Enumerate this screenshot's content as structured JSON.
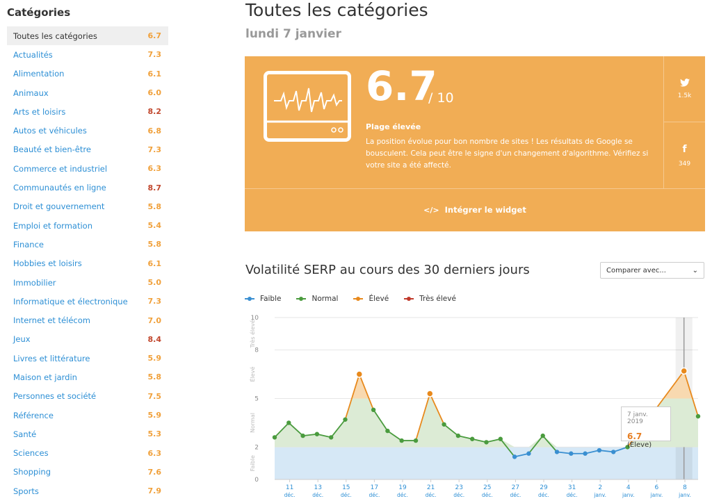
{
  "sidebar": {
    "title": "Catégories",
    "items": [
      {
        "label": "Toutes les catégories",
        "value": "6.7",
        "active": true,
        "color": "orange"
      },
      {
        "label": "Actualités",
        "value": "7.3",
        "color": "orange"
      },
      {
        "label": "Alimentation",
        "value": "6.1",
        "color": "orange"
      },
      {
        "label": "Animaux",
        "value": "6.0",
        "color": "orange"
      },
      {
        "label": "Arts et loisirs",
        "value": "8.2",
        "color": "red"
      },
      {
        "label": "Autos et véhicules",
        "value": "6.8",
        "color": "orange"
      },
      {
        "label": "Beauté et bien-être",
        "value": "7.3",
        "color": "orange"
      },
      {
        "label": "Commerce et industriel",
        "value": "6.3",
        "color": "orange"
      },
      {
        "label": "Communautés en ligne",
        "value": "8.7",
        "color": "red"
      },
      {
        "label": "Droit et gouvernement",
        "value": "5.8",
        "color": "orange"
      },
      {
        "label": "Emploi et formation",
        "value": "5.4",
        "color": "orange"
      },
      {
        "label": "Finance",
        "value": "5.8",
        "color": "orange"
      },
      {
        "label": "Hobbies et loisirs",
        "value": "6.1",
        "color": "orange"
      },
      {
        "label": "Immobilier",
        "value": "5.0",
        "color": "orange"
      },
      {
        "label": "Informatique et électronique",
        "value": "7.3",
        "color": "orange"
      },
      {
        "label": "Internet et télécom",
        "value": "7.0",
        "color": "orange"
      },
      {
        "label": "Jeux",
        "value": "8.4",
        "color": "red"
      },
      {
        "label": "Livres et littérature",
        "value": "5.9",
        "color": "orange"
      },
      {
        "label": "Maison et jardin",
        "value": "5.8",
        "color": "orange"
      },
      {
        "label": "Personnes et société",
        "value": "7.5",
        "color": "orange"
      },
      {
        "label": "Référence",
        "value": "5.9",
        "color": "orange"
      },
      {
        "label": "Santé",
        "value": "5.3",
        "color": "orange"
      },
      {
        "label": "Sciences",
        "value": "6.3",
        "color": "orange"
      },
      {
        "label": "Shopping",
        "value": "7.6",
        "color": "orange"
      },
      {
        "label": "Sports",
        "value": "7.9",
        "color": "orange"
      }
    ]
  },
  "header": {
    "title": "Toutes les catégories",
    "date": "lundi 7 janvier"
  },
  "card": {
    "score": "6.7",
    "score_max": "/ 10",
    "range_label": "Plage élevée",
    "description": "La position évolue pour bon nombre de sites ! Les résultats de Google se bousculent. Cela peut être le signe d'un changement d'algorithme. Vérifiez si votre site a été affecté.",
    "twitter_count": "1.5k",
    "facebook_count": "349",
    "embed_label": "Intégrer le widget",
    "bg_color": "#f1ad55"
  },
  "chart_section": {
    "title": "Volatilité SERP au cours des 30 derniers jours",
    "compare_label": "Comparer avec...",
    "legend": [
      {
        "name": "Faible",
        "color": "#3a8fd1"
      },
      {
        "name": "Normal",
        "color": "#4a9b3e"
      },
      {
        "name": "Élevé",
        "color": "#e8891c"
      },
      {
        "name": "Très élevé",
        "color": "#c0392b"
      }
    ],
    "tooltip": {
      "date": "7 janv. 2019",
      "value": "6.7",
      "label": "(Eleve)"
    }
  },
  "chart_data": {
    "type": "line",
    "ylim": [
      0,
      10
    ],
    "yticks": [
      0,
      2,
      5,
      8,
      10
    ],
    "band_labels": [
      "Faible",
      "Normal",
      "Élevé",
      "Très élevé"
    ],
    "bands": [
      0,
      2,
      5,
      8,
      10
    ],
    "xticks": [
      {
        "day": "11",
        "month": "déc."
      },
      {
        "day": "13",
        "month": "déc."
      },
      {
        "day": "15",
        "month": "déc."
      },
      {
        "day": "17",
        "month": "déc."
      },
      {
        "day": "19",
        "month": "déc."
      },
      {
        "day": "21",
        "month": "déc."
      },
      {
        "day": "23",
        "month": "déc."
      },
      {
        "day": "25",
        "month": "déc."
      },
      {
        "day": "27",
        "month": "déc."
      },
      {
        "day": "29",
        "month": "déc."
      },
      {
        "day": "31",
        "month": "déc."
      },
      {
        "day": "2",
        "month": "janv."
      },
      {
        "day": "4",
        "month": "janv."
      },
      {
        "day": "6",
        "month": "janv."
      },
      {
        "day": "8",
        "month": "janv."
      }
    ],
    "series": [
      {
        "values": [
          {
            "x": "2018-12-09",
            "y": 2.6
          },
          {
            "x": "2018-12-10",
            "y": 3.5
          },
          {
            "x": "2018-12-11",
            "y": 2.7
          },
          {
            "x": "2018-12-12",
            "y": 2.8
          },
          {
            "x": "2018-12-13",
            "y": 2.6
          },
          {
            "x": "2018-12-14",
            "y": 3.7
          },
          {
            "x": "2018-12-15",
            "y": 6.5
          },
          {
            "x": "2018-12-16",
            "y": 4.3
          },
          {
            "x": "2018-12-17",
            "y": 3.0
          },
          {
            "x": "2018-12-18",
            "y": 2.4
          },
          {
            "x": "2018-12-19",
            "y": 2.4
          },
          {
            "x": "2018-12-20",
            "y": 5.3
          },
          {
            "x": "2018-12-21",
            "y": 3.4
          },
          {
            "x": "2018-12-22",
            "y": 2.7
          },
          {
            "x": "2018-12-23",
            "y": 2.5
          },
          {
            "x": "2018-12-24",
            "y": 2.3
          },
          {
            "x": "2018-12-25",
            "y": 2.5
          },
          {
            "x": "2018-12-26",
            "y": 1.4
          },
          {
            "x": "2018-12-27",
            "y": 1.6
          },
          {
            "x": "2018-12-28",
            "y": 2.7
          },
          {
            "x": "2018-12-29",
            "y": 1.7
          },
          {
            "x": "2018-12-30",
            "y": 1.6
          },
          {
            "x": "2018-12-31",
            "y": 1.6
          },
          {
            "x": "2019-01-01",
            "y": 1.8
          },
          {
            "x": "2019-01-02",
            "y": 1.7
          },
          {
            "x": "2019-01-03",
            "y": 2.0
          },
          {
            "x": "2019-01-07",
            "y": 6.7
          },
          {
            "x": "2019-01-08",
            "y": 3.9
          }
        ]
      }
    ]
  }
}
